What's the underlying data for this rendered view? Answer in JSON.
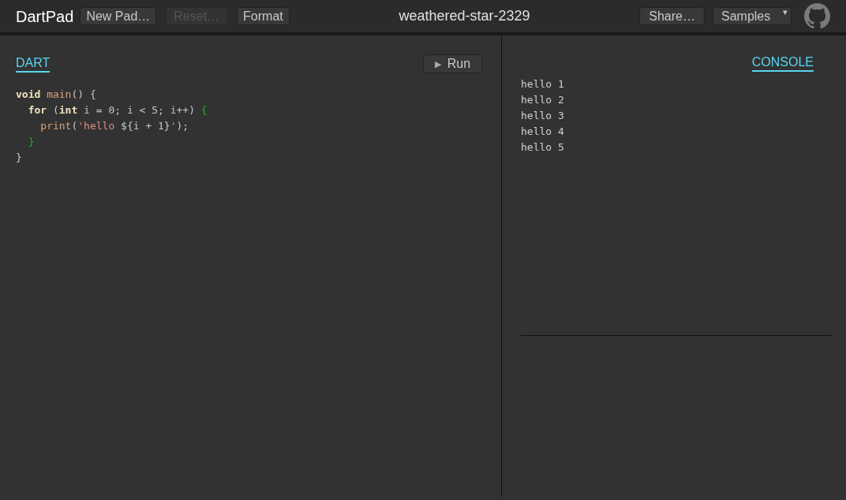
{
  "header": {
    "logo": "DartPad",
    "buttons": [
      {
        "label": "New Pad…",
        "disabled": false
      },
      {
        "label": "Reset…",
        "disabled": true
      },
      {
        "label": "Format",
        "disabled": false
      }
    ],
    "pad_title": "weathered-star-2329",
    "share_button": "Share…",
    "samples_dropdown": {
      "label": "Samples",
      "caret": "▾"
    }
  },
  "editor": {
    "tab": "DART",
    "run_button": {
      "icon": "▶",
      "label": "Run"
    },
    "lines": [
      [
        {
          "text": "void",
          "kind": "keyword"
        },
        {
          "text": " main",
          "kind": "name"
        },
        {
          "text": "() {",
          "kind": "plain"
        }
      ],
      [
        {
          "text": "  for",
          "kind": "keyword"
        },
        {
          "text": " (",
          "kind": "plain"
        },
        {
          "text": "int",
          "kind": "keyword"
        },
        {
          "text": " i = 0; i < 5; i++) ",
          "kind": "plain"
        },
        {
          "text": "{",
          "kind": "match"
        }
      ],
      [
        {
          "text": "    print",
          "kind": "name"
        },
        {
          "text": "(",
          "kind": "plain"
        },
        {
          "text": "'hello ",
          "kind": "string"
        },
        {
          "text": "${i + 1}",
          "kind": "plain"
        },
        {
          "text": "'",
          "kind": "string"
        },
        {
          "text": ");",
          "kind": "plain"
        }
      ],
      [
        {
          "text": "  }",
          "kind": "match"
        }
      ],
      [
        {
          "text": "}",
          "kind": "plain"
        }
      ]
    ]
  },
  "console": {
    "tab": "CONSOLE",
    "output": [
      "hello 1",
      "hello 2",
      "hello 3",
      "hello 4",
      "hello 5"
    ]
  }
}
